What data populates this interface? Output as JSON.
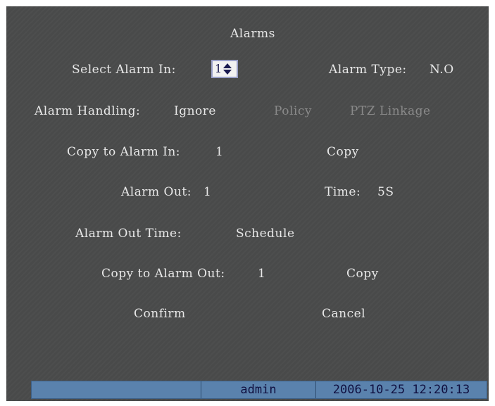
{
  "title": "Alarms",
  "select_alarm_in": {
    "label": "Select Alarm In:",
    "value": "1"
  },
  "alarm_type": {
    "label": "Alarm Type:",
    "value": "N.O"
  },
  "alarm_handling": {
    "label": "Alarm Handling:",
    "value": "Ignore",
    "policy": "Policy",
    "ptz_linkage": "PTZ Linkage"
  },
  "copy_to_alarm_in": {
    "label": "Copy to Alarm In:",
    "value": "1",
    "copy": "Copy"
  },
  "alarm_out": {
    "label": "Alarm Out:",
    "value": "1"
  },
  "time": {
    "label": "Time:",
    "value": "5S"
  },
  "alarm_out_time": {
    "label": "Alarm Out Time:",
    "value": "Schedule"
  },
  "copy_to_alarm_out": {
    "label": "Copy to Alarm Out:",
    "value": "1",
    "copy": "Copy"
  },
  "buttons": {
    "confirm": "Confirm",
    "cancel": "Cancel"
  },
  "status_bar": {
    "user": "admin",
    "datetime": "2006-10-25 12:20:13"
  },
  "colors": {
    "background": "#4a4b4b",
    "text": "#e8e8e8",
    "disabled_text": "#8a8a8a",
    "status_bar": "#5a82ad",
    "spin_focus_border": "#9aa0c8"
  }
}
